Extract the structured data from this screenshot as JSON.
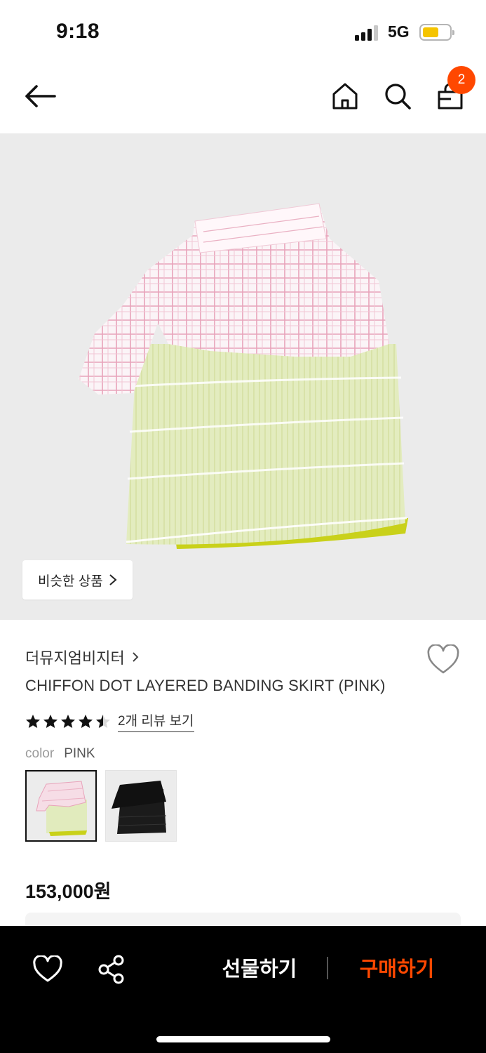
{
  "status_bar": {
    "time": "9:18",
    "network": "5G"
  },
  "header": {
    "cart_count": "2"
  },
  "gallery": {
    "similar_button_label": "비슷한 상품"
  },
  "product": {
    "brand": "더뮤지엄비지터",
    "title": "CHIFFON DOT LAYERED BANDING SKIRT (PINK)",
    "rating": 4.5,
    "rating_max": 5,
    "review_link": "2개 리뷰 보기",
    "color_label": "color",
    "color_value": "PINK",
    "swatches": [
      {
        "name": "pink",
        "selected": true
      },
      {
        "name": "black",
        "selected": false
      }
    ],
    "price": "153,000원"
  },
  "bottom_bar": {
    "gift_label": "선물하기",
    "buy_label": "구매하기"
  },
  "colors": {
    "accent": "#ff4800",
    "bottom_bar_bg": "#000000",
    "image_bg": "#ebebeb"
  }
}
